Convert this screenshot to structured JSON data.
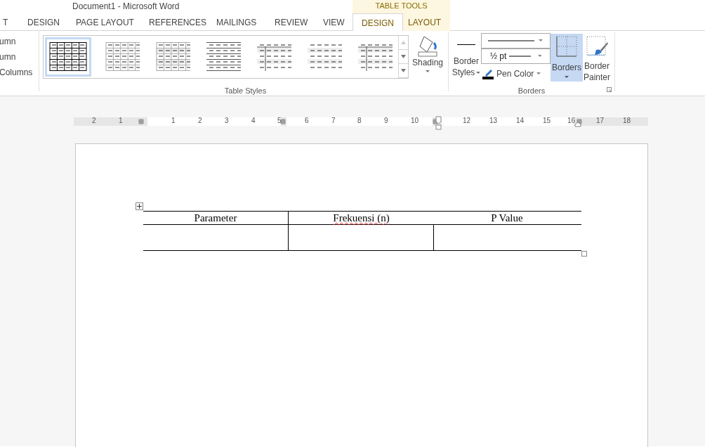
{
  "window": {
    "title": "Document1 - Microsoft Word"
  },
  "contextual_group": {
    "title": "TABLE TOOLS"
  },
  "tabs": [
    {
      "label": "T",
      "selected": false,
      "contextual": false
    },
    {
      "label": "DESIGN",
      "selected": false,
      "contextual": false
    },
    {
      "label": "PAGE LAYOUT",
      "selected": false,
      "contextual": false
    },
    {
      "label": "REFERENCES",
      "selected": false,
      "contextual": false
    },
    {
      "label": "MAILINGS",
      "selected": false,
      "contextual": false
    },
    {
      "label": "REVIEW",
      "selected": false,
      "contextual": false
    },
    {
      "label": "VIEW",
      "selected": false,
      "contextual": false
    },
    {
      "label": "DESIGN",
      "selected": true,
      "contextual": true
    },
    {
      "label": "LAYOUT",
      "selected": false,
      "contextual": true
    }
  ],
  "options_group": {
    "items": [
      "umn",
      "umn",
      "Columns"
    ]
  },
  "table_styles": {
    "label": "Table Styles",
    "styles": [
      {
        "kind": "grid",
        "selected": true
      },
      {
        "kind": "light-grid",
        "selected": false
      },
      {
        "kind": "shaded-grid",
        "selected": false
      },
      {
        "kind": "lines",
        "selected": false
      },
      {
        "kind": "first-column",
        "selected": false
      },
      {
        "kind": "banded",
        "selected": false
      },
      {
        "kind": "first-column",
        "selected": false
      }
    ],
    "shading": "Shading"
  },
  "borders": {
    "label": "Borders",
    "border_styles": [
      "Border",
      "Styles"
    ],
    "line_weight": "½ pt",
    "pen_color": "Pen Color",
    "borders_button": {
      "label": "Borders",
      "selected": true
    },
    "border_painter": [
      "Border",
      "Painter"
    ]
  },
  "ruler": {
    "labels": [
      "2",
      "1",
      "1",
      "2",
      "3",
      "4",
      "5",
      "6",
      "7",
      "8",
      "9",
      "10",
      "12",
      "13",
      "14",
      "15",
      "16",
      "17",
      "18"
    ]
  },
  "document": {
    "table": {
      "header": [
        {
          "text": "Parameter",
          "misspelled": false
        },
        {
          "text": "Frekuensi (n)",
          "misspelled": true
        },
        {
          "text": "P Value",
          "misspelled": false
        }
      ]
    }
  }
}
